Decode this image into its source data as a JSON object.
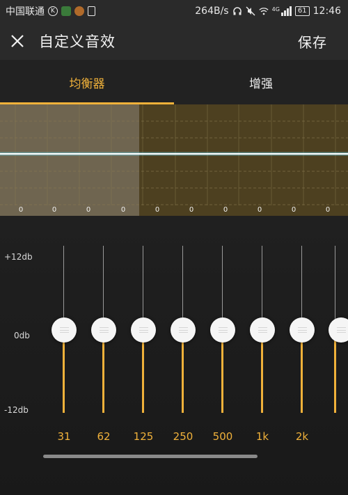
{
  "status_bar": {
    "carrier": "中国联通",
    "speed": "264B/s",
    "network": "4G",
    "battery": "61",
    "time": "12:46",
    "icons": [
      "carrier-k-icon",
      "green-app-icon",
      "orange-app-icon",
      "document-icon",
      "headset-icon",
      "mute-icon",
      "wifi-icon",
      "signal-icon",
      "battery-icon"
    ]
  },
  "app_bar": {
    "title": "自定义音效",
    "save_label": "保存",
    "close_icon": "close-icon"
  },
  "tabs": [
    {
      "label": "均衡器",
      "active": true
    },
    {
      "label": "增强",
      "active": false
    }
  ],
  "preview": {
    "values": [
      "0",
      "0",
      "0",
      "0",
      "0",
      "0",
      "0",
      "0",
      "0",
      "0"
    ]
  },
  "equalizer": {
    "db_labels": {
      "max": "+12db",
      "mid": "0db",
      "min": "-12db"
    },
    "range_db": [
      -12,
      12
    ],
    "accent_color": "#f0b13a",
    "bands": [
      {
        "freq": "31",
        "gain_db": 0
      },
      {
        "freq": "62",
        "gain_db": 0
      },
      {
        "freq": "125",
        "gain_db": 0
      },
      {
        "freq": "250",
        "gain_db": 0
      },
      {
        "freq": "500",
        "gain_db": 0
      },
      {
        "freq": "1k",
        "gain_db": 0
      },
      {
        "freq": "2k",
        "gain_db": 0
      },
      {
        "freq": "",
        "gain_db": 0
      }
    ]
  }
}
